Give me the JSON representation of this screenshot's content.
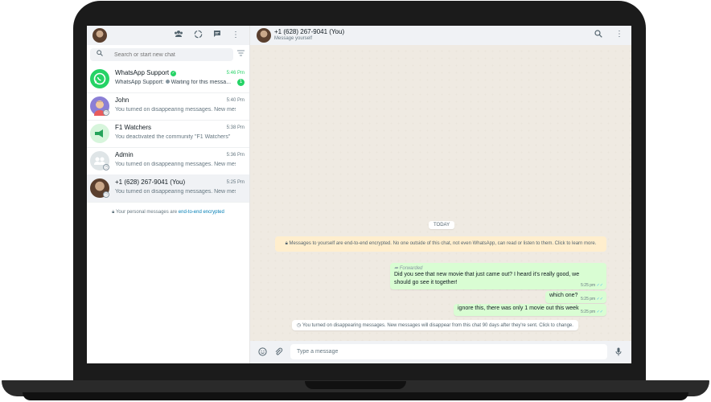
{
  "sidebar": {
    "search_placeholder": "Search or start new chat",
    "chats": [
      {
        "name": "WhatsApp Support",
        "time": "5:46 Pm",
        "preview_prefix": "WhatsApp Support:",
        "preview": "Waiting for this messa...",
        "unread": "1",
        "verified": "✓"
      },
      {
        "name": "John",
        "time": "5:40 Pm",
        "preview": "You turned on disappearing messages. New mess..."
      },
      {
        "name": "F1 Watchers",
        "time": "5:38 Pm",
        "preview": "You deactivated the community \"F1 Watchers\""
      },
      {
        "name": "Admin",
        "time": "5:36 Pm",
        "preview": "You turned on disappearing messages. New mess..."
      },
      {
        "name": "+1 (628) 267-9041 (You)",
        "time": "5:25 Pm",
        "preview": "You turned on disappearing messages. New mess..."
      }
    ],
    "encryption_note": "Your personal messages are",
    "encryption_link": "end-to-end encrypted"
  },
  "conversation": {
    "title": "+1 (628) 267-9041 (You)",
    "subtitle": "Message yourself",
    "day_label": "TODAY",
    "system_notice": "Messages to yourself are end-to-end encrypted. No one outside of this chat, not even WhatsApp, can read or listen to them. Click to learn more.",
    "messages": [
      {
        "forwarded": "Forwarded",
        "text": "Did you see that new movie that just came out? I heard it's really good, we should go see it together!",
        "time": "5:25 pm"
      },
      {
        "text": "which one?",
        "time": "5:25 pm"
      },
      {
        "text": "ignore this, there was only 1 movie out this week",
        "time": "5:25 pm"
      }
    ],
    "disappearing_notice": "You turned on disappearing messages. New messages will disappear from this chat 90 days after they're sent. Click to change.",
    "composer_placeholder": "Type a message"
  },
  "colors": {
    "accent": "#25d366",
    "outgoing_bubble": "#d9fdd3",
    "notice": "#ffeecd",
    "chat_bg": "#efeae2"
  },
  "icons": [
    "community-icon",
    "status-icon",
    "new-chat-icon",
    "menu-icon",
    "search-icon",
    "filter-icon",
    "emoji-icon",
    "attach-icon",
    "mic-icon",
    "lock-icon",
    "timer-icon",
    "forward-icon"
  ]
}
